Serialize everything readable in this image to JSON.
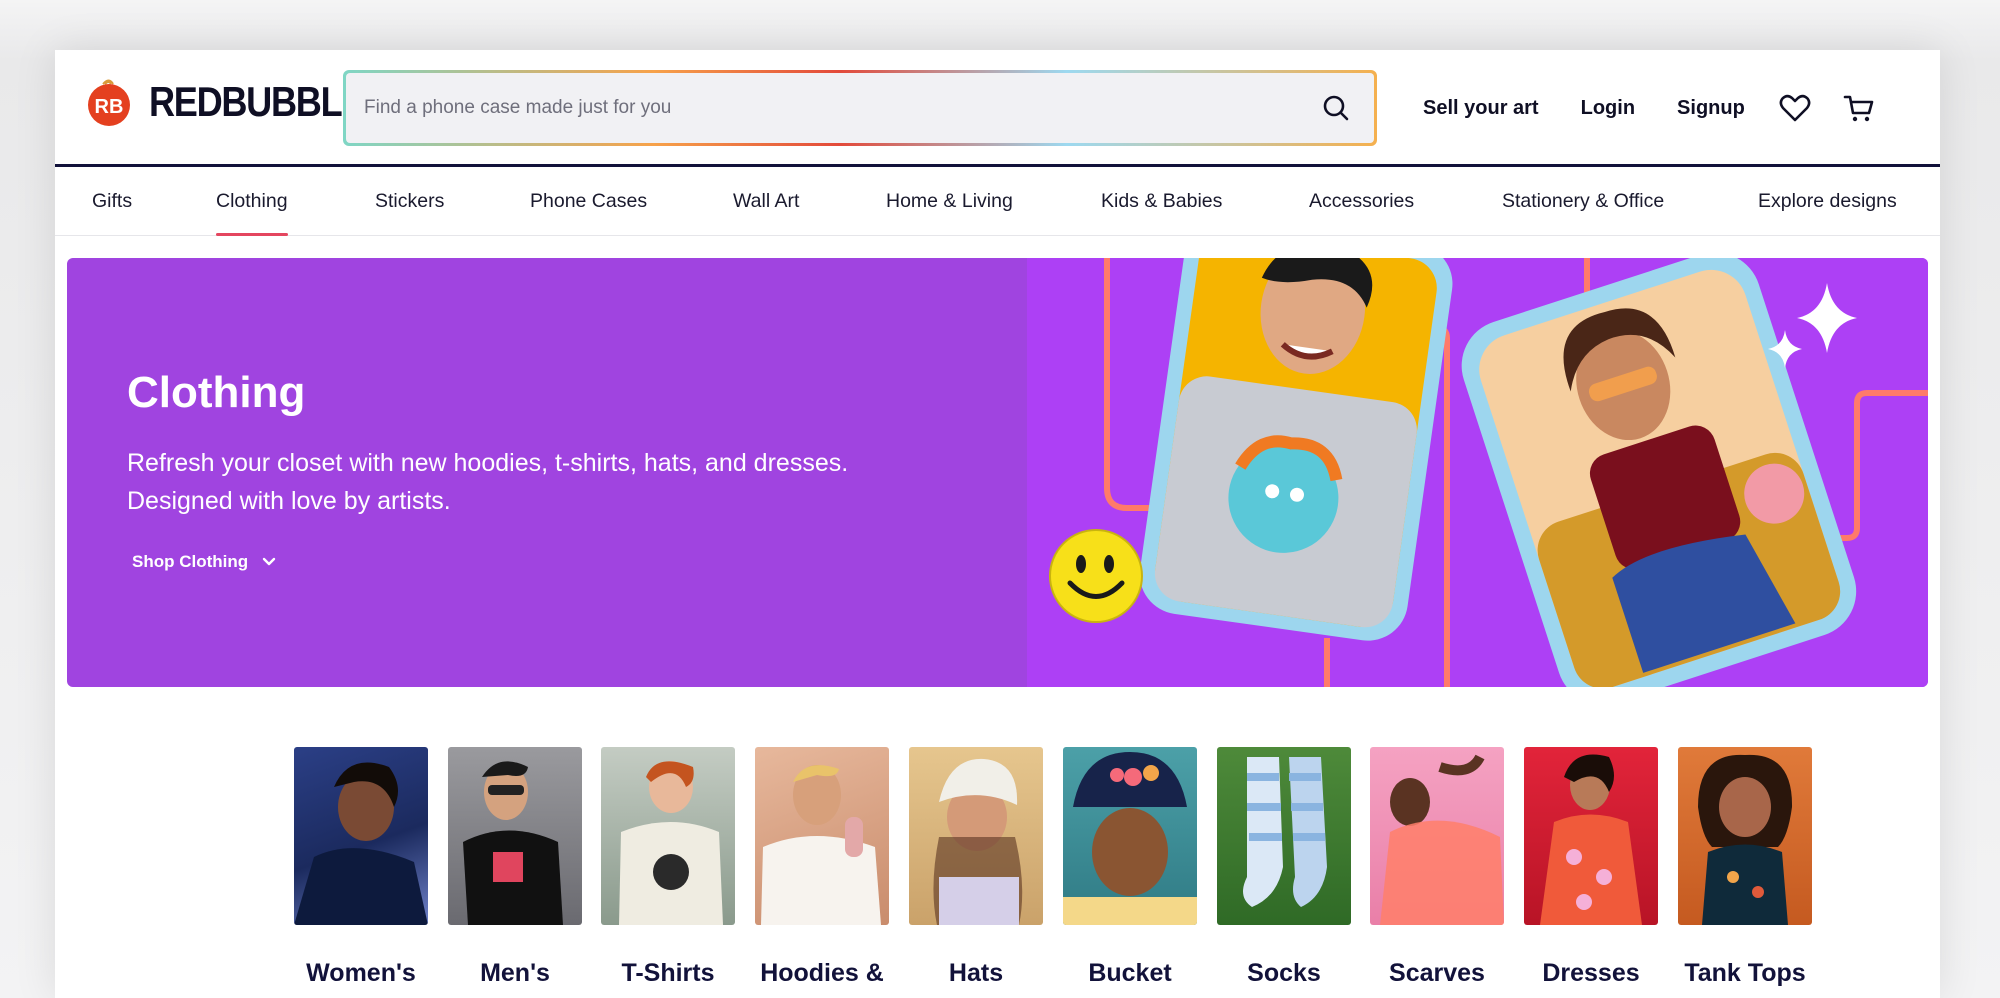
{
  "brand": {
    "name": "REDBUBBLE",
    "logo_letters": "RB",
    "color": "#e4401f"
  },
  "search": {
    "placeholder": "Find a phone case made just for you"
  },
  "header": {
    "links": [
      "Sell your art",
      "Login",
      "Signup"
    ],
    "icons": [
      "heart-icon",
      "cart-icon"
    ]
  },
  "nav": {
    "items": [
      "Gifts",
      "Clothing",
      "Stickers",
      "Phone Cases",
      "Wall Art",
      "Home & Living",
      "Kids & Babies",
      "Accessories",
      "Stationery & Office",
      "Explore designs"
    ],
    "active": "Clothing",
    "active_color": "#e4465f"
  },
  "hero": {
    "title": "Clothing",
    "subtitle": "Refresh your closet with new hoodies, t-shirts, hats, and dresses. Designed with love by artists.",
    "cta": "Shop Clothing",
    "background": "#a044e0"
  },
  "categories": [
    {
      "label": "Women's"
    },
    {
      "label": "Men's"
    },
    {
      "label": "T-Shirts"
    },
    {
      "label": "Hoodies &"
    },
    {
      "label": "Hats"
    },
    {
      "label": "Bucket"
    },
    {
      "label": "Socks"
    },
    {
      "label": "Scarves"
    },
    {
      "label": "Dresses"
    },
    {
      "label": "Tank Tops"
    }
  ]
}
